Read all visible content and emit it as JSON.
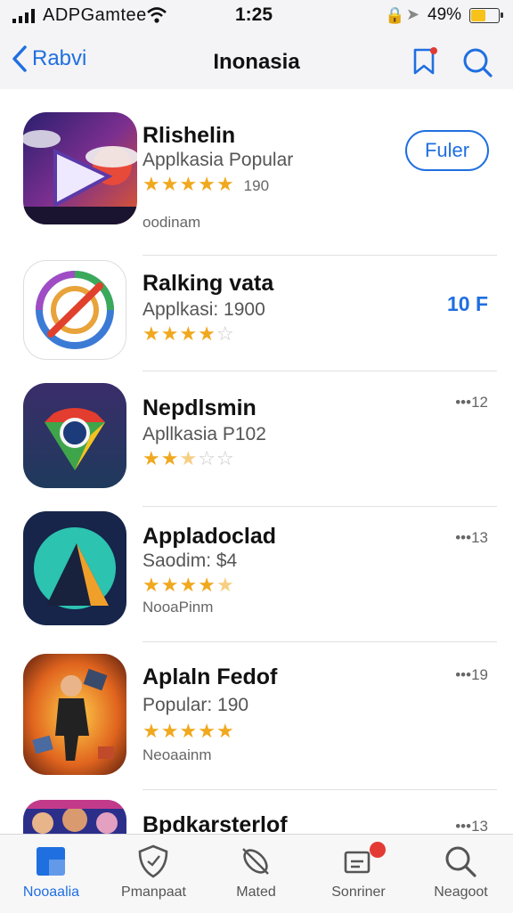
{
  "status_bar": {
    "carrier": "ADPGamtee",
    "time": "1:25",
    "battery_text": "49%",
    "battery_level": 0.49
  },
  "nav": {
    "back_label": "Rabvi",
    "title": "Inonasia"
  },
  "apps": [
    {
      "name": "Rlishelin",
      "subtitle": "Applkasia Popular",
      "rating": 5,
      "rating_count": "190",
      "extra": "oodinam",
      "action_label": "Fuler"
    },
    {
      "name": "Ralking vata",
      "subtitle": "Applkasi: 1900",
      "rating": 4,
      "price": "10 F"
    },
    {
      "name": "Nepdlsmin",
      "subtitle": "Apllkasia P102",
      "rating": 2.5,
      "meta": "•••12"
    },
    {
      "name": "Appladoclad",
      "subtitle": "Saodim:  $4",
      "rating": 4.5,
      "extra": "NooaPinm",
      "meta": "•••13"
    },
    {
      "name": "Aplaln Fedof",
      "subtitle": "Popular: 190",
      "rating": 5,
      "extra": "Neoaainm",
      "meta": "•••19"
    },
    {
      "name": "Bpdkarsterlof",
      "meta": "•••13"
    }
  ],
  "tabs": [
    {
      "label": "Nooaalia",
      "icon": "today-icon",
      "active": true
    },
    {
      "label": "Pmanpaat",
      "icon": "shield-icon",
      "active": false
    },
    {
      "label": "Mated",
      "icon": "games-icon",
      "active": false
    },
    {
      "label": "Sonriner",
      "icon": "updates-icon",
      "active": false
    },
    {
      "label": "Neagoot",
      "icon": "search-icon",
      "active": false
    }
  ],
  "colors": {
    "accent": "#1f6fe0",
    "star": "#f0a81e",
    "badge": "#e33b33",
    "battery": "#f7c21a"
  }
}
